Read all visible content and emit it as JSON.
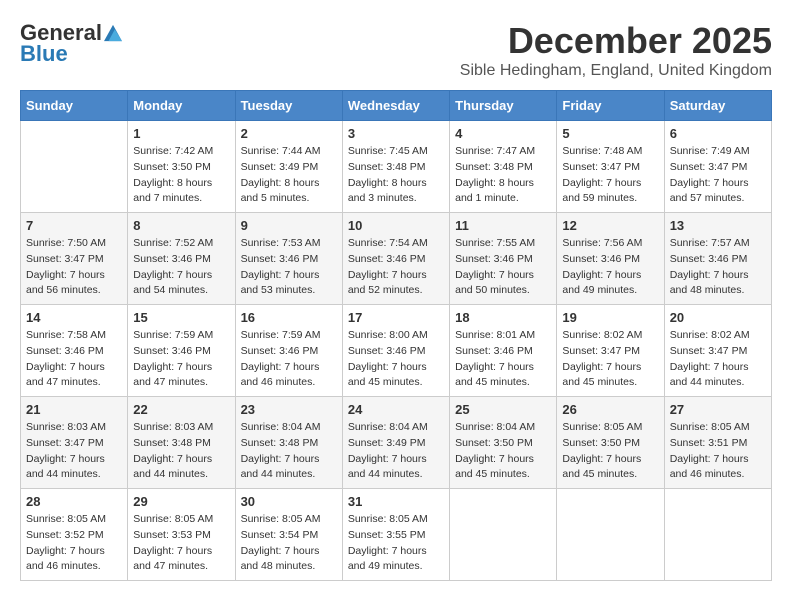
{
  "logo": {
    "general": "General",
    "blue": "Blue"
  },
  "title": "December 2025",
  "location": "Sible Hedingham, England, United Kingdom",
  "days_of_week": [
    "Sunday",
    "Monday",
    "Tuesday",
    "Wednesday",
    "Thursday",
    "Friday",
    "Saturday"
  ],
  "weeks": [
    [
      {
        "day": "",
        "info": ""
      },
      {
        "day": "1",
        "info": "Sunrise: 7:42 AM\nSunset: 3:50 PM\nDaylight: 8 hours\nand 7 minutes."
      },
      {
        "day": "2",
        "info": "Sunrise: 7:44 AM\nSunset: 3:49 PM\nDaylight: 8 hours\nand 5 minutes."
      },
      {
        "day": "3",
        "info": "Sunrise: 7:45 AM\nSunset: 3:48 PM\nDaylight: 8 hours\nand 3 minutes."
      },
      {
        "day": "4",
        "info": "Sunrise: 7:47 AM\nSunset: 3:48 PM\nDaylight: 8 hours\nand 1 minute."
      },
      {
        "day": "5",
        "info": "Sunrise: 7:48 AM\nSunset: 3:47 PM\nDaylight: 7 hours\nand 59 minutes."
      },
      {
        "day": "6",
        "info": "Sunrise: 7:49 AM\nSunset: 3:47 PM\nDaylight: 7 hours\nand 57 minutes."
      }
    ],
    [
      {
        "day": "7",
        "info": "Sunrise: 7:50 AM\nSunset: 3:47 PM\nDaylight: 7 hours\nand 56 minutes."
      },
      {
        "day": "8",
        "info": "Sunrise: 7:52 AM\nSunset: 3:46 PM\nDaylight: 7 hours\nand 54 minutes."
      },
      {
        "day": "9",
        "info": "Sunrise: 7:53 AM\nSunset: 3:46 PM\nDaylight: 7 hours\nand 53 minutes."
      },
      {
        "day": "10",
        "info": "Sunrise: 7:54 AM\nSunset: 3:46 PM\nDaylight: 7 hours\nand 52 minutes."
      },
      {
        "day": "11",
        "info": "Sunrise: 7:55 AM\nSunset: 3:46 PM\nDaylight: 7 hours\nand 50 minutes."
      },
      {
        "day": "12",
        "info": "Sunrise: 7:56 AM\nSunset: 3:46 PM\nDaylight: 7 hours\nand 49 minutes."
      },
      {
        "day": "13",
        "info": "Sunrise: 7:57 AM\nSunset: 3:46 PM\nDaylight: 7 hours\nand 48 minutes."
      }
    ],
    [
      {
        "day": "14",
        "info": "Sunrise: 7:58 AM\nSunset: 3:46 PM\nDaylight: 7 hours\nand 47 minutes."
      },
      {
        "day": "15",
        "info": "Sunrise: 7:59 AM\nSunset: 3:46 PM\nDaylight: 7 hours\nand 47 minutes."
      },
      {
        "day": "16",
        "info": "Sunrise: 7:59 AM\nSunset: 3:46 PM\nDaylight: 7 hours\nand 46 minutes."
      },
      {
        "day": "17",
        "info": "Sunrise: 8:00 AM\nSunset: 3:46 PM\nDaylight: 7 hours\nand 45 minutes."
      },
      {
        "day": "18",
        "info": "Sunrise: 8:01 AM\nSunset: 3:46 PM\nDaylight: 7 hours\nand 45 minutes."
      },
      {
        "day": "19",
        "info": "Sunrise: 8:02 AM\nSunset: 3:47 PM\nDaylight: 7 hours\nand 45 minutes."
      },
      {
        "day": "20",
        "info": "Sunrise: 8:02 AM\nSunset: 3:47 PM\nDaylight: 7 hours\nand 44 minutes."
      }
    ],
    [
      {
        "day": "21",
        "info": "Sunrise: 8:03 AM\nSunset: 3:47 PM\nDaylight: 7 hours\nand 44 minutes."
      },
      {
        "day": "22",
        "info": "Sunrise: 8:03 AM\nSunset: 3:48 PM\nDaylight: 7 hours\nand 44 minutes."
      },
      {
        "day": "23",
        "info": "Sunrise: 8:04 AM\nSunset: 3:48 PM\nDaylight: 7 hours\nand 44 minutes."
      },
      {
        "day": "24",
        "info": "Sunrise: 8:04 AM\nSunset: 3:49 PM\nDaylight: 7 hours\nand 44 minutes."
      },
      {
        "day": "25",
        "info": "Sunrise: 8:04 AM\nSunset: 3:50 PM\nDaylight: 7 hours\nand 45 minutes."
      },
      {
        "day": "26",
        "info": "Sunrise: 8:05 AM\nSunset: 3:50 PM\nDaylight: 7 hours\nand 45 minutes."
      },
      {
        "day": "27",
        "info": "Sunrise: 8:05 AM\nSunset: 3:51 PM\nDaylight: 7 hours\nand 46 minutes."
      }
    ],
    [
      {
        "day": "28",
        "info": "Sunrise: 8:05 AM\nSunset: 3:52 PM\nDaylight: 7 hours\nand 46 minutes."
      },
      {
        "day": "29",
        "info": "Sunrise: 8:05 AM\nSunset: 3:53 PM\nDaylight: 7 hours\nand 47 minutes."
      },
      {
        "day": "30",
        "info": "Sunrise: 8:05 AM\nSunset: 3:54 PM\nDaylight: 7 hours\nand 48 minutes."
      },
      {
        "day": "31",
        "info": "Sunrise: 8:05 AM\nSunset: 3:55 PM\nDaylight: 7 hours\nand 49 minutes."
      },
      {
        "day": "",
        "info": ""
      },
      {
        "day": "",
        "info": ""
      },
      {
        "day": "",
        "info": ""
      }
    ]
  ]
}
